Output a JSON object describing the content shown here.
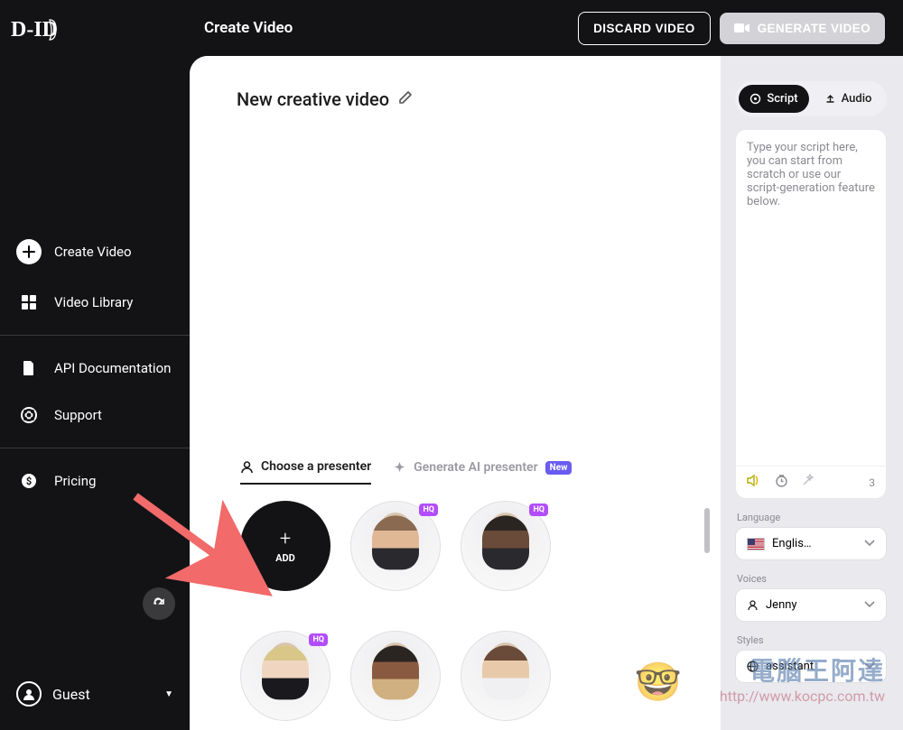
{
  "logo_text": "D-ID",
  "sidebar": {
    "items": [
      {
        "label": "Create Video",
        "icon": "plus"
      },
      {
        "label": "Video Library",
        "icon": "grid"
      },
      {
        "label": "API Documentation",
        "icon": "doc"
      },
      {
        "label": "Support",
        "icon": "life-ring"
      },
      {
        "label": "Pricing",
        "icon": "dollar"
      }
    ],
    "user": "Guest"
  },
  "topbar": {
    "title": "Create Video",
    "discard": "DISCARD VIDEO",
    "generate": "GENERATE VIDEO"
  },
  "video": {
    "title": "New creative video"
  },
  "presenter": {
    "choose_label": "Choose a presenter",
    "generate_label": "Generate AI presenter",
    "new_badge": "New",
    "add_label": "ADD",
    "hq_badge": "HQ"
  },
  "panel": {
    "script_tab": "Script",
    "audio_tab": "Audio",
    "placeholder": "Type your script here, you can start from scratch or use our script-generation feature below.",
    "char_count": "3",
    "language_label": "Language",
    "language_value": "Englis…",
    "voices_label": "Voices",
    "voices_value": "Jenny",
    "styles_label": "Styles",
    "styles_value": "assistant"
  },
  "watermark": {
    "title": "電腦王阿達",
    "url": "http://www.kocpc.com.tw"
  }
}
